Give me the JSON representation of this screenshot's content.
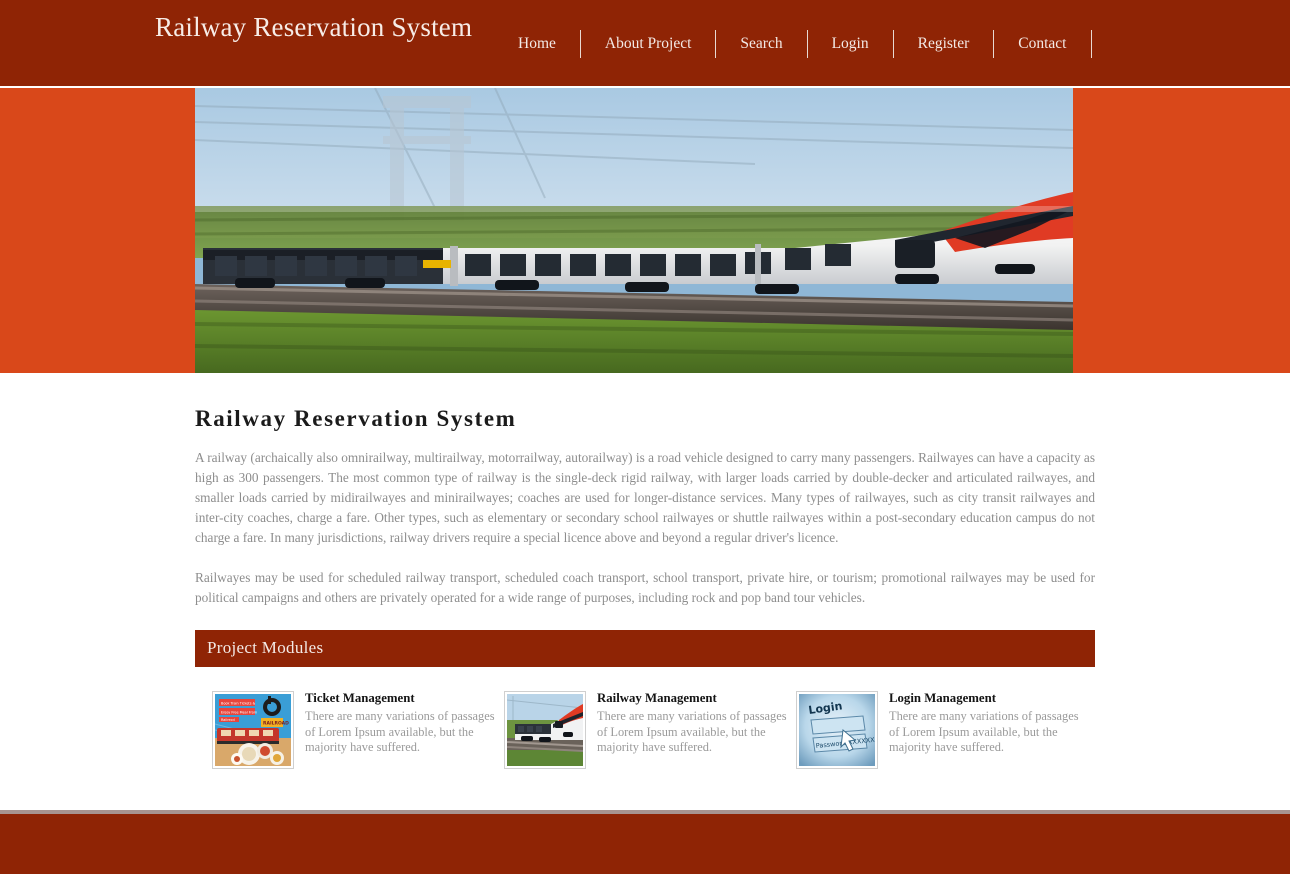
{
  "theme": {
    "header_bg": "#8f2405",
    "accent_orange": "#d9481a",
    "footer_bg": "#8f2405",
    "body_text": "#8d8d8d",
    "heading_text": "#1b1b1b"
  },
  "header": {
    "brand": "Railway Reservation System",
    "nav": [
      {
        "label": "Home"
      },
      {
        "label": "About Project"
      },
      {
        "label": "Search"
      },
      {
        "label": "Login"
      },
      {
        "label": "Register"
      },
      {
        "label": "Contact"
      }
    ]
  },
  "hero": {
    "image_alt": "high-speed-train-photo"
  },
  "main": {
    "page_title": "Railway Reservation System",
    "paragraph_1": "A railway (archaically also omnirailway, multirailway, motorrailway, autorailway) is a road vehicle designed to carry many passengers. Railwayes can have a capacity as high as 300 passengers. The most common type of railway is the single-deck rigid railway, with larger loads carried by double-decker and articulated railwayes, and smaller loads carried by midirailwayes and minirailwayes; coaches are used for longer-distance services. Many types of railwayes, such as city transit railwayes and inter-city coaches, charge a fare. Other types, such as elementary or secondary school railwayes or shuttle railwayes within a post-secondary education campus do not charge a fare. In many jurisdictions, railway drivers require a special licence above and beyond a regular driver's licence.",
    "paragraph_2": "Railwayes may be used for scheduled railway transport, scheduled coach transport, school transport, private hire, or tourism; promotional railwayes may be used for political campaigns and others are privately operated for a wide range of purposes, including rock and pop band tour vehicles.",
    "modules_heading": "Project Modules",
    "modules": [
      {
        "title": "Ticket Management",
        "description": "There are many variations of passages of Lorem Ipsum available, but the majority have suffered.",
        "thumb": "train-ticket-meal-ad-thumbnail"
      },
      {
        "title": "Railway Management",
        "description": "There are many variations of passages of Lorem Ipsum available, but the majority have suffered.",
        "thumb": "modern-train-thumbnail"
      },
      {
        "title": "Login Management",
        "description": "There are many variations of passages of Lorem Ipsum available, but the majority have suffered.",
        "thumb": "login-form-thumbnail"
      }
    ]
  }
}
